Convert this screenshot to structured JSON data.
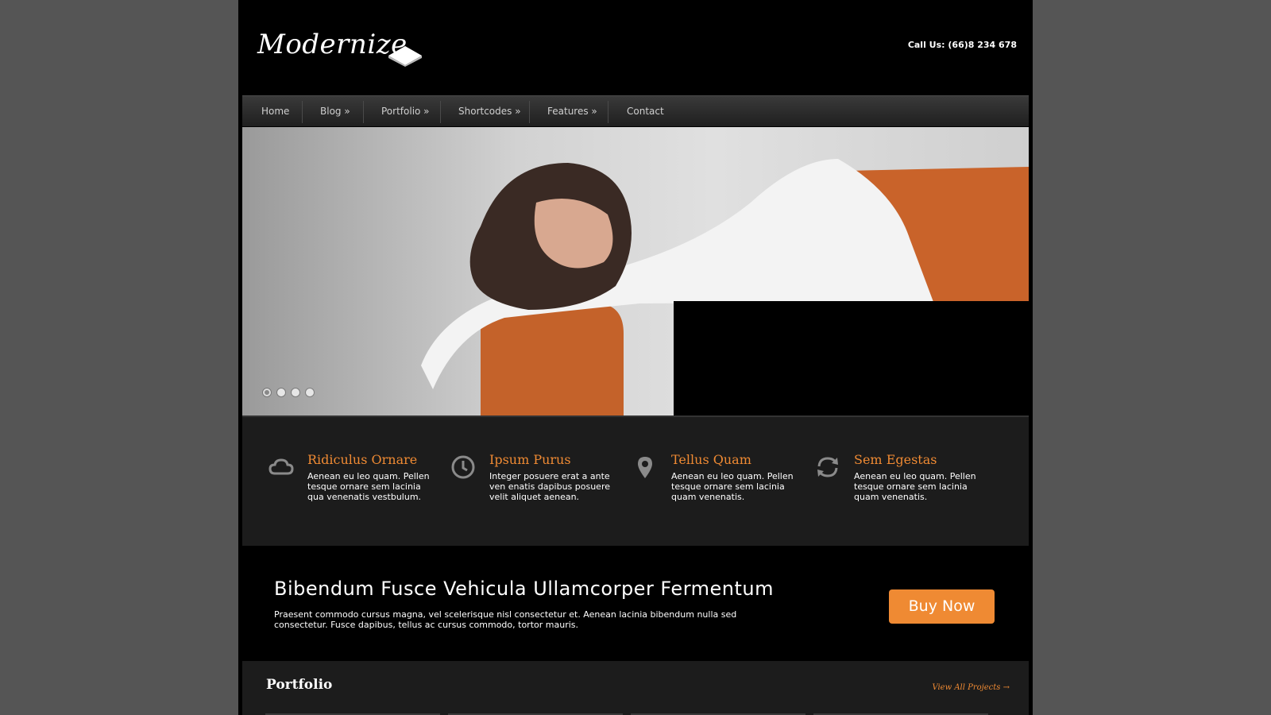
{
  "brand": {
    "logo_text": "Modernize"
  },
  "header": {
    "call_us": "Call Us: (66)8 234 678"
  },
  "nav": {
    "items": [
      "Home",
      "Blog »",
      "Portfolio »",
      "Shortcodes »",
      "Features »",
      "Contact"
    ]
  },
  "slider": {
    "slides_count": 4,
    "active_index": 0
  },
  "features": [
    {
      "icon": "cloud-icon",
      "title": "Ridiculus Ornare",
      "text": "Aenean eu leo quam. Pellen tesque ornare sem lacinia qua venenatis vestbulum."
    },
    {
      "icon": "clock-icon",
      "title": "Ipsum Purus",
      "text": "Integer posuere erat a ante ven enatis dapibus posuere velit aliquet aenean."
    },
    {
      "icon": "map-pin-icon",
      "title": "Tellus Quam",
      "text": "Aenean eu leo quam. Pellen tesque ornare sem lacinia quam venenatis."
    },
    {
      "icon": "refresh-icon",
      "title": "Sem Egestas",
      "text": "Aenean eu leo quam. Pellen tesque ornare sem lacinia quam venenatis."
    }
  ],
  "cta": {
    "title": "Bibendum Fusce Vehicula Ullamcorper Fermentum",
    "text": "Praesent commodo cursus magna, vel scelerisque nisl consectetur et. Aenean lacinia bibendum nulla sed consectetur. Fusce dapibus, tellus ac cursus commodo, tortor mauris.",
    "button": "Buy Now"
  },
  "portfolio": {
    "title": "Portfolio",
    "view_all": "View All Projects →"
  },
  "colors": {
    "accent": "#ef8a33",
    "page_bg": "#555555",
    "content_bg": "#000000",
    "panel_bg": "#1c1c1c"
  }
}
